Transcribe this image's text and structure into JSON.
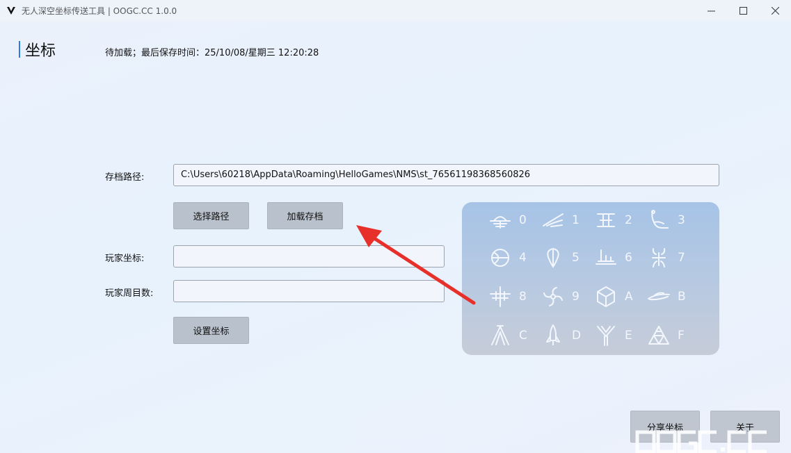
{
  "window": {
    "title": "无人深空坐标传送工具 | OOGC.CC 1.0.0",
    "controls": [
      "minimize",
      "maximize",
      "close"
    ]
  },
  "header": {
    "page_title": "坐标",
    "status": "待加载；最后保存时间：25/10/08/星期三 12:20:28"
  },
  "form": {
    "save_path_label": "存档路径:",
    "save_path_value": "C:\\Users\\60218\\AppData\\Roaming\\HelloGames\\NMS\\st_76561198368560826",
    "choose_path_button": "选择路径",
    "load_save_button": "加载存档",
    "player_coords_label": "玩家坐标:",
    "player_coords_value": "",
    "player_cycle_label": "玩家周目数:",
    "player_cycle_value": "",
    "set_coords_button": "设置坐标"
  },
  "glyphs": [
    {
      "char": "0",
      "icon": "sunset-glyph-icon"
    },
    {
      "char": "1",
      "icon": "bird-glyph-icon"
    },
    {
      "char": "2",
      "icon": "face-glyph-icon"
    },
    {
      "char": "3",
      "icon": "diplo-glyph-icon"
    },
    {
      "char": "4",
      "icon": "eclipse-glyph-icon"
    },
    {
      "char": "5",
      "icon": "balloon-glyph-icon"
    },
    {
      "char": "6",
      "icon": "boat-glyph-icon"
    },
    {
      "char": "7",
      "icon": "bug-glyph-icon"
    },
    {
      "char": "8",
      "icon": "dragonfly-glyph-icon"
    },
    {
      "char": "9",
      "icon": "galaxy-glyph-icon"
    },
    {
      "char": "A",
      "icon": "voxel-glyph-icon"
    },
    {
      "char": "B",
      "icon": "fish-glyph-icon"
    },
    {
      "char": "C",
      "icon": "tent-glyph-icon"
    },
    {
      "char": "D",
      "icon": "rocket-glyph-icon"
    },
    {
      "char": "E",
      "icon": "tree-glyph-icon"
    },
    {
      "char": "F",
      "icon": "atlas-glyph-icon"
    }
  ],
  "footer": {
    "share_button": "分享坐标",
    "about_button": "关于",
    "watermark": "OOGC.CC"
  },
  "colors": {
    "accent": "#2c7be5",
    "arrow": "#e8302a",
    "button": "#b9c2cc"
  }
}
